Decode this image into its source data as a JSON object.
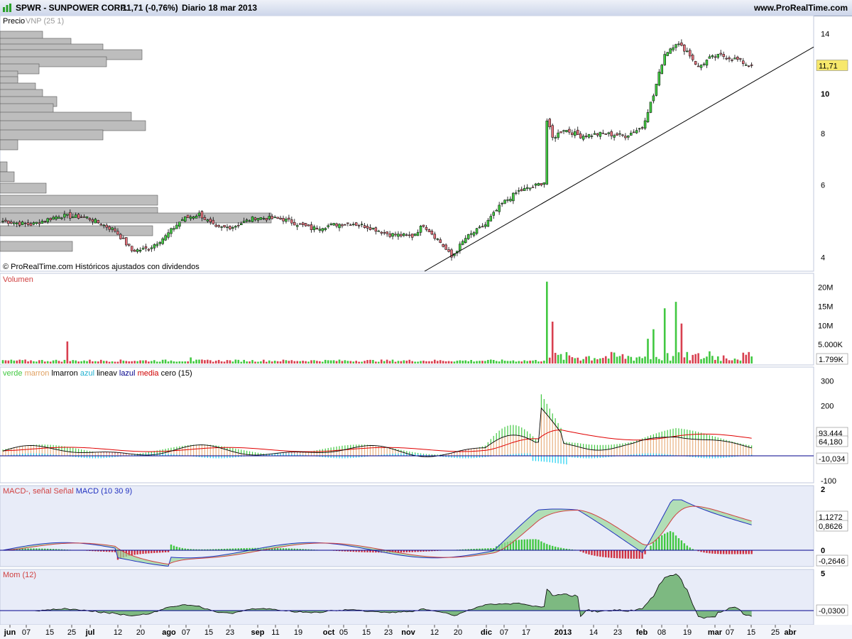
{
  "header": {
    "symbol": "SPWR - SUNPOWER CORP.",
    "last": "11,71 (-0,76%)",
    "period": "Diario  18 mar 2013",
    "brand": "www.ProRealTime.com"
  },
  "colors": {
    "up": "#41c841",
    "down": "#e0707a",
    "panel_bg": "#f0f3fb",
    "sep": "#c0c8dc",
    "trend": "#000000"
  },
  "chart_data": [
    {
      "type": "candlestick",
      "title": "Precio",
      "indicator": "VNP (25 1)",
      "footer": "© ProRealTime.com  Históricos ajustados con dividendos",
      "y_ticks": [
        "14",
        "10",
        "8",
        "6",
        "4"
      ],
      "y_scale": "log",
      "last_label": "11,71",
      "x_ticks": [
        "jun",
        "07",
        "15",
        "25",
        "jul",
        "12",
        "20",
        "ago",
        "07",
        "15",
        "23",
        "sep",
        "11",
        "19",
        "oct",
        "05",
        "15",
        "23",
        "nov",
        "12",
        "20",
        "dic",
        "07",
        "17",
        "2013",
        "14",
        "23",
        "feb",
        "08",
        "19",
        "mar",
        "07",
        "15",
        "25",
        "abr"
      ],
      "close_keypoints": [
        [
          0,
          4.9
        ],
        [
          10,
          4.8
        ],
        [
          20,
          5.05
        ],
        [
          30,
          5.0
        ],
        [
          40,
          4.65
        ],
        [
          46,
          4.15
        ],
        [
          52,
          4.2
        ],
        [
          58,
          4.5
        ],
        [
          64,
          4.95
        ],
        [
          70,
          5.1
        ],
        [
          76,
          4.7
        ],
        [
          82,
          4.75
        ],
        [
          90,
          5.0
        ],
        [
          100,
          4.95
        ],
        [
          110,
          4.7
        ],
        [
          118,
          4.8
        ],
        [
          124,
          4.85
        ],
        [
          130,
          4.75
        ],
        [
          138,
          4.55
        ],
        [
          146,
          4.5
        ],
        [
          150,
          4.8
        ],
        [
          156,
          4.35
        ],
        [
          160,
          4.0
        ],
        [
          165,
          4.45
        ],
        [
          172,
          4.8
        ],
        [
          178,
          5.4
        ],
        [
          184,
          5.8
        ],
        [
          188,
          5.9
        ],
        [
          193,
          6.1
        ],
        [
          194,
          8.6
        ],
        [
          196,
          7.8
        ],
        [
          200,
          8.2
        ],
        [
          206,
          7.9
        ],
        [
          214,
          8.0
        ],
        [
          222,
          7.9
        ],
        [
          228,
          8.3
        ],
        [
          232,
          9.9
        ],
        [
          236,
          12.5
        ],
        [
          240,
          13.3
        ],
        [
          244,
          12.7
        ],
        [
          248,
          11.6
        ],
        [
          252,
          12.2
        ],
        [
          256,
          12.4
        ],
        [
          262,
          12.1
        ],
        [
          266,
          11.71
        ]
      ],
      "trendline": {
        "from": [
          "jul-dic",
          "4"
        ],
        "to": [
          "abr",
          "13"
        ]
      },
      "volume_profile": "VNP (25 1)"
    },
    {
      "type": "bar",
      "title": "Volumen",
      "y_ticks": [
        "20M",
        "15M",
        "10M",
        "5.000K"
      ],
      "last_label": "1.799K",
      "spikes": [
        [
          23,
          5.8
        ],
        [
          67,
          1.6
        ],
        [
          194,
          21.5
        ],
        [
          196,
          11
        ],
        [
          236,
          14.5
        ],
        [
          240,
          16.2
        ],
        [
          242,
          10.5
        ],
        [
          232,
          9
        ],
        [
          230,
          6.5
        ],
        [
          252,
          3.2
        ]
      ],
      "base": 0.45
    },
    {
      "type": "area",
      "title": "verde marron lmarron azul lineav lazul media cero (15)",
      "y_ticks": [
        "300",
        "200",
        "-100"
      ],
      "last_labels": [
        "93,444",
        "64,180",
        "-10,034"
      ]
    },
    {
      "type": "line",
      "title": "MACD-, señal Señal MACD (10 30 9)",
      "y_ticks": [
        "2",
        "0"
      ],
      "last_labels": [
        "1,1272",
        "0,8626",
        "-0,2646"
      ]
    },
    {
      "type": "area",
      "title": "Mom (12)",
      "y_ticks": [
        "5",
        "0"
      ],
      "last_label": "-0,0300"
    }
  ]
}
